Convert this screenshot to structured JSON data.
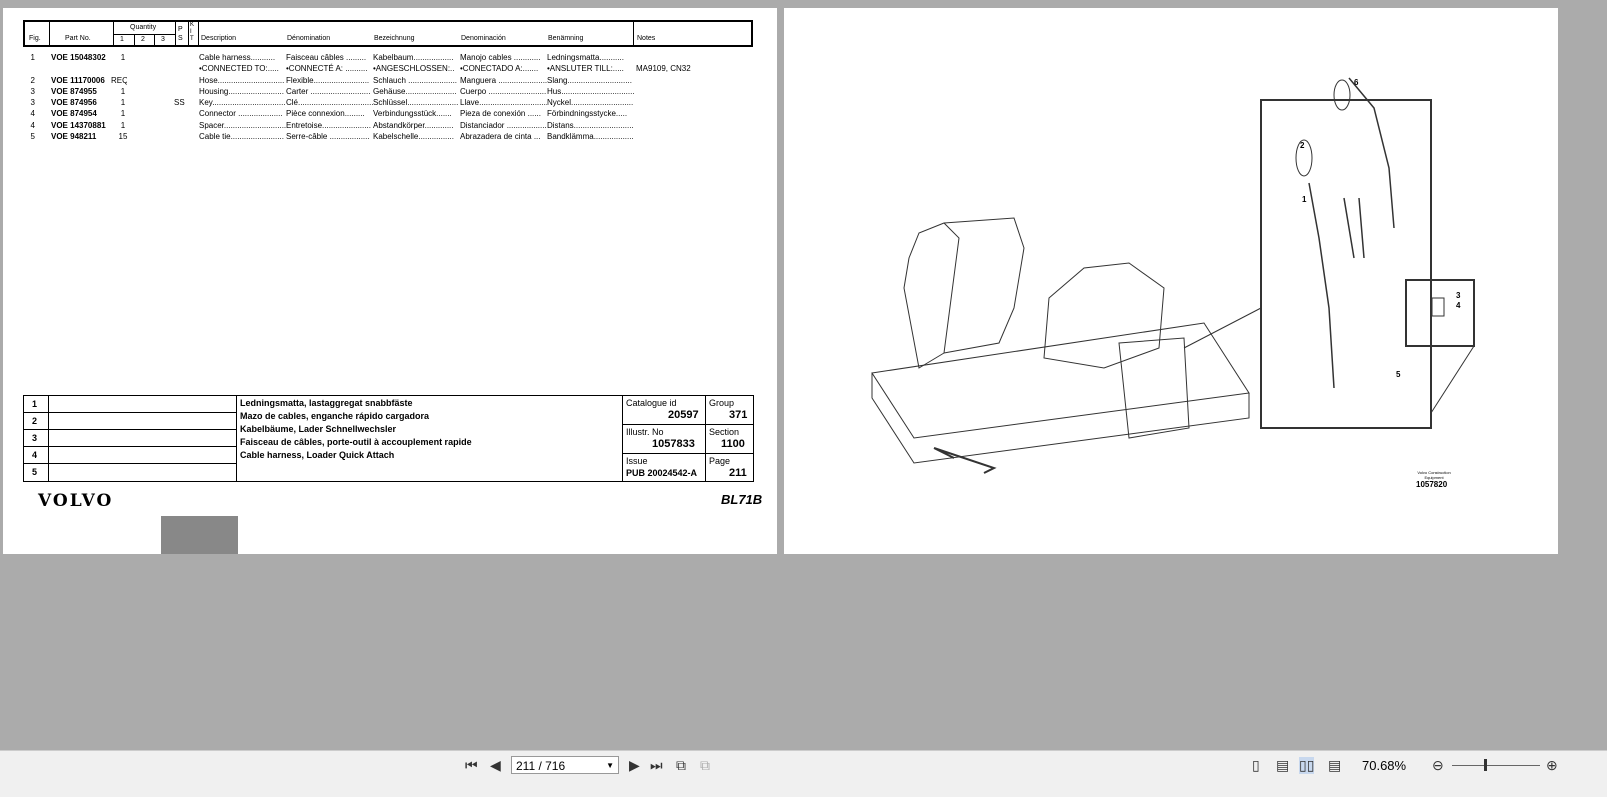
{
  "parts_table": {
    "headers": {
      "fig": "Fig.",
      "part_no": "Part No.",
      "quantity": "Quantity",
      "q1": "1",
      "q2": "2",
      "q3": "3",
      "ps": "P S",
      "kit": "K I T",
      "description": "Description",
      "denomination_fr": "Dénomination",
      "bezeichnung": "Bezeichnung",
      "denominacion": "Denominación",
      "benamning": "Benämning",
      "notes": "Notes"
    },
    "rows": [
      {
        "fig": "1",
        "part_no": "VOE 15048302",
        "qty": "1",
        "ps": "",
        "en": "Cable harness...........",
        "fr": "Faisceau câbles .........",
        "de": "Kabelbaum..................",
        "es": "Manojo cables ............",
        "sv": "Ledningsmatta...........",
        "notes": ""
      },
      {
        "fig": "",
        "part_no": "",
        "qty": "",
        "ps": "",
        "en": "•CONNECTED TO:.....",
        "fr": "•CONNECTÉ A: ..........",
        "de": "•ANGESCHLOSSEN:..",
        "es": "•CONECTADO A:.......",
        "sv": "•ANSLUTER TILL:.....",
        "notes": "MA9109, CN32"
      },
      {
        "fig": "2",
        "part_no": "VOE 11170006",
        "qty": "REQ",
        "ps": "",
        "en": "Hose..............................",
        "fr": "Flexible.........................",
        "de": "Schlauch ......................",
        "es": "Manguera ......................",
        "sv": "Slang.............................",
        "notes": ""
      },
      {
        "fig": "3",
        "part_no": "VOE 874955",
        "qty": "1",
        "ps": "",
        "en": "Housing.........................",
        "fr": "Carter ...........................",
        "de": "Gehäuse.......................",
        "es": "Cuerpo ..........................",
        "sv": "Hus.................................",
        "notes": ""
      },
      {
        "fig": "3",
        "part_no": "VOE 874956",
        "qty": "1",
        "ps": "SS",
        "en": "Key.................................",
        "fr": "Clé..................................",
        "de": "Schlüssel.......................",
        "es": "Llave................................",
        "sv": "Nyckel............................",
        "notes": ""
      },
      {
        "fig": "4",
        "part_no": "VOE 874954",
        "qty": "1",
        "ps": "",
        "en": "Connector ....................",
        "fr": "Pièce connexion.........",
        "de": "Verbindungsstück.......",
        "es": "Pieza de conexión ......",
        "sv": "Förbindningsstycke.....",
        "notes": ""
      },
      {
        "fig": "4",
        "part_no": "VOE 14370881",
        "qty": "1",
        "ps": "",
        "en": "Spacer............................",
        "fr": "Entretoise......................",
        "de": "Abstandkörper.............",
        "es": "Distanciador ..................",
        "sv": "Distans...........................",
        "notes": ""
      },
      {
        "fig": "5",
        "part_no": "VOE 948211",
        "qty": "15",
        "ps": "",
        "en": "Cable tie........................",
        "fr": "Serre-câble ..................",
        "de": "Kabelschelle................",
        "es": "Abrazadera de cinta ...",
        "sv": "Bandklämma...................",
        "notes": ""
      }
    ]
  },
  "title_block": {
    "row_numbers": [
      "1",
      "2",
      "3",
      "4",
      "5"
    ],
    "titles": [
      "Ledningsmatta, lastaggregat snabbfäste",
      "Mazo de cables, enganche rápido cargadora",
      "Kabelbäume, Lader Schnellwechsler",
      "Faisceau de câbles, porte-outil à accouplement rapide",
      "Cable harness, Loader Quick Attach"
    ],
    "catalogue_label": "Catalogue id",
    "catalogue_id": "20597",
    "group_label": "Group",
    "group": "371",
    "illustr_label": "Illustr. No",
    "illustr_no": "1057833",
    "section_label": "Section",
    "section": "1100",
    "issue_label": "Issue",
    "issue": "PUB 20024542-A",
    "page_label": "Page",
    "page": "211"
  },
  "brand": "VOLVO",
  "model": "BL71B",
  "illustration": {
    "callouts": [
      "1",
      "2",
      "3",
      "4",
      "5",
      "6"
    ],
    "credit": "Volvo Construction Equipment",
    "number": "1057820"
  },
  "toolbar": {
    "page_input": "211 / 716",
    "zoom": "70.68%"
  }
}
